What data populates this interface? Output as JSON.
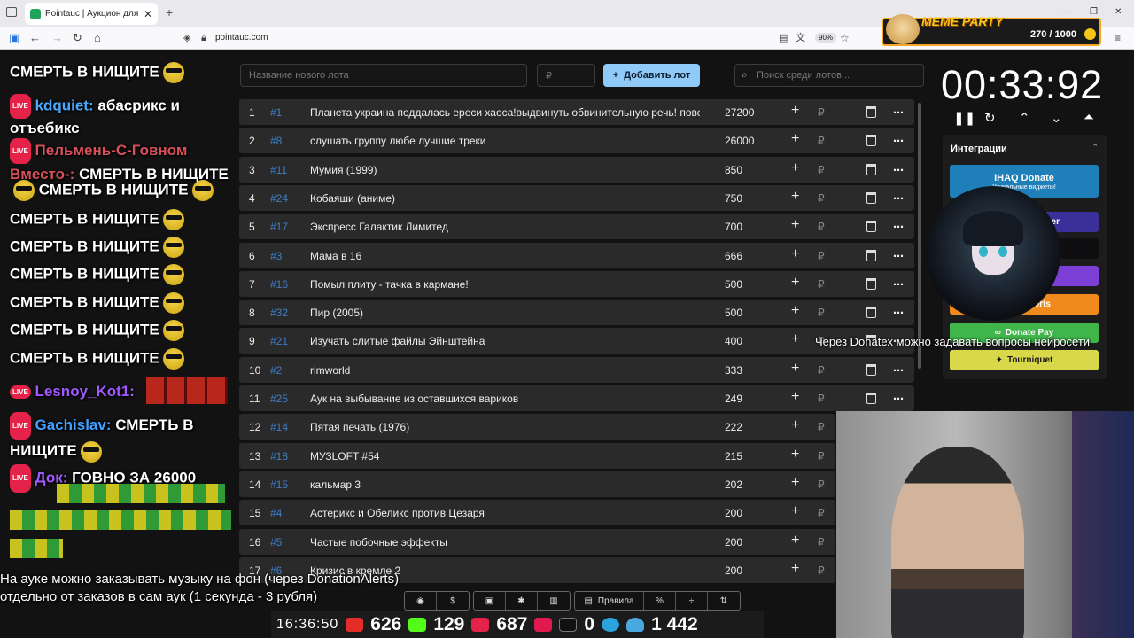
{
  "browser": {
    "tab_title": "Pointauc | Аукцион для стримеров",
    "url": "pointauc.com",
    "zoom": "90%"
  },
  "chat": {
    "lines": [
      {
        "text": "СМЕРТЬ В НИЩИТЕ"
      },
      {
        "user": "kdquiet:",
        "text": "абасрикс и отъебикс"
      },
      {
        "user": "Пельмень-С-Говном Вместо-:",
        "text": "СМЕРТЬ В НИЩИТЕ"
      },
      {
        "text": "СМЕРТЬ В НИЩИТЕ"
      },
      {
        "text": "СМЕРТЬ В НИЩИТЕ"
      },
      {
        "text": "СМЕРТЬ В НИЩИТЕ"
      },
      {
        "text": "СМЕРТЬ В НИЩИТЕ"
      },
      {
        "text": "СМЕРТЬ В НИЩИТЕ"
      },
      {
        "text": "СМЕРТЬ В НИЩИТЕ"
      },
      {
        "text": "СМЕРТЬ В НИЩИТЕ"
      },
      {
        "user": "Lesnoy_Kot1:"
      },
      {
        "user": "Gachislav:",
        "text": "СМЕРТЬ В НИЩИТЕ"
      },
      {
        "user": "Док:",
        "text": "ГОВНО ЗА 26000"
      }
    ],
    "live_badge": "LIVE"
  },
  "toolbar": {
    "new_lot_placeholder": "Название нового лота",
    "amount_placeholder": "₽",
    "add_button": "Добавить лот",
    "search_placeholder": "Поиск среди лотов..."
  },
  "lots": [
    {
      "rank": "1",
      "id": "#1",
      "name": "Планета украина поддалась ереси хаоса!выдвинуть обвинительную речь! повет",
      "amount": "27200"
    },
    {
      "rank": "2",
      "id": "#8",
      "name": "слушать группу любе лучшие треки",
      "amount": "26000"
    },
    {
      "rank": "3",
      "id": "#11",
      "name": "Мумия (1999)",
      "amount": "850"
    },
    {
      "rank": "4",
      "id": "#24",
      "name": "Кобаяши (аниме)",
      "amount": "750"
    },
    {
      "rank": "5",
      "id": "#17",
      "name": "Экспресс Галактик Лимитед",
      "amount": "700"
    },
    {
      "rank": "6",
      "id": "#3",
      "name": "Мама в 16",
      "amount": "666"
    },
    {
      "rank": "7",
      "id": "#16",
      "name": "Помыл плиту - тачка в кармане!",
      "amount": "500"
    },
    {
      "rank": "8",
      "id": "#32",
      "name": "Пир (2005)",
      "amount": "500"
    },
    {
      "rank": "9",
      "id": "#21",
      "name": "Изучать слитые файлы Эйнштейна",
      "amount": "400"
    },
    {
      "rank": "10",
      "id": "#2",
      "name": "rimworld",
      "amount": "333"
    },
    {
      "rank": "11",
      "id": "#25",
      "name": "Аук на выбывание из оставшихся вариков",
      "amount": "249"
    },
    {
      "rank": "12",
      "id": "#14",
      "name": "Пятая печать (1976)",
      "amount": "222"
    },
    {
      "rank": "13",
      "id": "#18",
      "name": "МУЗLOFT #54",
      "amount": "215"
    },
    {
      "rank": "14",
      "id": "#15",
      "name": "кальмар 3",
      "amount": "202"
    },
    {
      "rank": "15",
      "id": "#4",
      "name": "Астерикс и Обеликс против Цезаря",
      "amount": "200"
    },
    {
      "rank": "16",
      "id": "#5",
      "name": "Частые побочные эффекты",
      "amount": "200"
    },
    {
      "rank": "17",
      "id": "#6",
      "name": "Кризис в кремле 2",
      "amount": "200"
    }
  ],
  "currency": "₽",
  "timer": "00:33:92",
  "integrations": {
    "title": "Интеграции",
    "buttons": [
      {
        "label": "IHAQ Donate",
        "sub": "Уникальные виджеты!",
        "color": "#1f6fb0"
      },
      {
        "label": "er",
        "color": "#3b2f9a"
      },
      {
        "label": "",
        "color": "#1a1a1a"
      },
      {
        "label": "",
        "color": "#7b3fd6"
      },
      {
        "label": "Alerts",
        "color": "#f08a1c"
      },
      {
        "label": "Donate Pay",
        "color": "#3fb54a"
      },
      {
        "label": "Tourniquet",
        "color": "#d8d84a"
      }
    ]
  },
  "meme_party": {
    "logo": "MEME PARTY",
    "count": "270 / 1000"
  },
  "overlay": {
    "bottom_note_1": "На ауке можно заказывать музыку на фон (через DonationAlerts)",
    "bottom_note_2": "отдельно от заказов в сам аук (1 секунда - 3 рубля)",
    "side_note": "Через Donatex можно задавать вопросы нейросети"
  },
  "bottom_toolbar": {
    "rules": "Правила",
    "percent": "%"
  },
  "stats": {
    "time": "16:36:50",
    "youtube": "626",
    "kick": "129",
    "live": "687",
    "rutube": "0",
    "viewers": "1 442"
  }
}
